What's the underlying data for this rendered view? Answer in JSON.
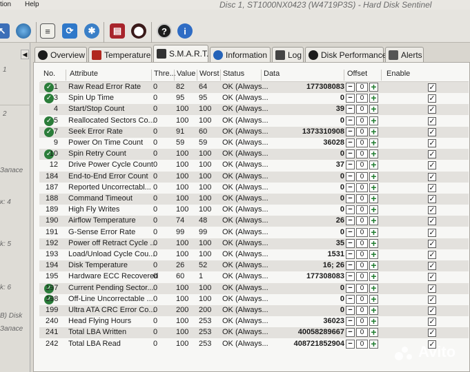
{
  "window": {
    "title": "Disc 1, ST1000NX0423 (W4719P3S) - Hard Disk Sentinel",
    "menu": [
      "tion",
      "Help"
    ]
  },
  "left_pane": [
    "1",
    "2",
    "Запасе",
    "к: 4",
    "k: 5",
    "k: 6",
    "B) Disk",
    "Запасе"
  ],
  "tabs": [
    {
      "label": "Overview",
      "icon": "overview-icon",
      "active": false
    },
    {
      "label": "Temperature",
      "icon": "temperature-icon",
      "active": false
    },
    {
      "label": "S.M.A.R.T.",
      "icon": "smart-icon",
      "active": true
    },
    {
      "label": "Information",
      "icon": "information-icon",
      "active": false
    },
    {
      "label": "Log",
      "icon": "log-icon",
      "active": false
    },
    {
      "label": "Disk Performance",
      "icon": "disk-performance-icon",
      "active": false
    },
    {
      "label": "Alerts",
      "icon": "alerts-icon",
      "active": false
    }
  ],
  "smart_table": {
    "headers": {
      "no": "No.",
      "attribute": "Attribute",
      "threshold": "Thre...",
      "value": "Value",
      "worst": "Worst",
      "status": "Status",
      "data": "Data",
      "offset": "Offset",
      "enable": "Enable"
    },
    "rows": [
      {
        "no": "1",
        "attribute": "Raw Read Error Rate",
        "threshold": "0",
        "value": "82",
        "worst": "64",
        "status": "OK (Always...",
        "data": "177308083",
        "offset": "0",
        "ok_icon": true,
        "enabled": true
      },
      {
        "no": "3",
        "attribute": "Spin Up Time",
        "threshold": "0",
        "value": "95",
        "worst": "95",
        "status": "OK (Always...",
        "data": "0",
        "offset": "0",
        "ok_icon": true,
        "enabled": true
      },
      {
        "no": "4",
        "attribute": "Start/Stop Count",
        "threshold": "0",
        "value": "100",
        "worst": "100",
        "status": "OK (Always...",
        "data": "39",
        "offset": "0",
        "ok_icon": false,
        "enabled": true
      },
      {
        "no": "5",
        "attribute": "Reallocated Sectors Co...",
        "threshold": "0",
        "value": "100",
        "worst": "100",
        "status": "OK (Always...",
        "data": "0",
        "offset": "0",
        "ok_icon": true,
        "enabled": true
      },
      {
        "no": "7",
        "attribute": "Seek Error Rate",
        "threshold": "0",
        "value": "91",
        "worst": "60",
        "status": "OK (Always...",
        "data": "1373310908",
        "offset": "0",
        "ok_icon": true,
        "enabled": true
      },
      {
        "no": "9",
        "attribute": "Power On Time Count",
        "threshold": "0",
        "value": "59",
        "worst": "59",
        "status": "OK (Always...",
        "data": "36028",
        "offset": "0",
        "ok_icon": false,
        "enabled": true
      },
      {
        "no": "10",
        "attribute": "Spin Retry Count",
        "threshold": "0",
        "value": "100",
        "worst": "100",
        "status": "OK (Always...",
        "data": "0",
        "offset": "0",
        "ok_icon": true,
        "enabled": true
      },
      {
        "no": "12",
        "attribute": "Drive Power Cycle Count",
        "threshold": "0",
        "value": "100",
        "worst": "100",
        "status": "OK (Always...",
        "data": "37",
        "offset": "0",
        "ok_icon": false,
        "enabled": true
      },
      {
        "no": "184",
        "attribute": "End-to-End Error Count",
        "threshold": "0",
        "value": "100",
        "worst": "100",
        "status": "OK (Always...",
        "data": "0",
        "offset": "0",
        "ok_icon": false,
        "enabled": true
      },
      {
        "no": "187",
        "attribute": "Reported Uncorrectabl...",
        "threshold": "0",
        "value": "100",
        "worst": "100",
        "status": "OK (Always...",
        "data": "0",
        "offset": "0",
        "ok_icon": false,
        "enabled": true
      },
      {
        "no": "188",
        "attribute": "Command Timeout",
        "threshold": "0",
        "value": "100",
        "worst": "100",
        "status": "OK (Always...",
        "data": "0",
        "offset": "0",
        "ok_icon": false,
        "enabled": true
      },
      {
        "no": "189",
        "attribute": "High Fly Writes",
        "threshold": "0",
        "value": "100",
        "worst": "100",
        "status": "OK (Always...",
        "data": "0",
        "offset": "0",
        "ok_icon": false,
        "enabled": true
      },
      {
        "no": "190",
        "attribute": "Airflow Temperature",
        "threshold": "0",
        "value": "74",
        "worst": "48",
        "status": "OK (Always...",
        "data": "26",
        "offset": "0",
        "ok_icon": false,
        "enabled": true
      },
      {
        "no": "191",
        "attribute": "G-Sense Error Rate",
        "threshold": "0",
        "value": "99",
        "worst": "99",
        "status": "OK (Always...",
        "data": "0",
        "offset": "0",
        "ok_icon": false,
        "enabled": true
      },
      {
        "no": "192",
        "attribute": "Power off Retract Cycle ...",
        "threshold": "0",
        "value": "100",
        "worst": "100",
        "status": "OK (Always...",
        "data": "35",
        "offset": "0",
        "ok_icon": false,
        "enabled": true
      },
      {
        "no": "193",
        "attribute": "Load/Unload Cycle Cou...",
        "threshold": "0",
        "value": "100",
        "worst": "100",
        "status": "OK (Always...",
        "data": "1531",
        "offset": "0",
        "ok_icon": false,
        "enabled": true
      },
      {
        "no": "194",
        "attribute": "Disk Temperature",
        "threshold": "0",
        "value": "26",
        "worst": "52",
        "status": "OK (Always...",
        "data": "16; 26",
        "offset": "0",
        "ok_icon": false,
        "enabled": true
      },
      {
        "no": "195",
        "attribute": "Hardware ECC Recovered",
        "threshold": "0",
        "value": "60",
        "worst": "1",
        "status": "OK (Always...",
        "data": "177308083",
        "offset": "0",
        "ok_icon": false,
        "enabled": true
      },
      {
        "no": "197",
        "attribute": "Current Pending Sector...",
        "threshold": "0",
        "value": "100",
        "worst": "100",
        "status": "OK (Always...",
        "data": "0",
        "offset": "0",
        "ok_icon": true,
        "enabled": true
      },
      {
        "no": "198",
        "attribute": "Off-Line Uncorrectable ...",
        "threshold": "0",
        "value": "100",
        "worst": "100",
        "status": "OK (Always...",
        "data": "0",
        "offset": "0",
        "ok_icon": true,
        "enabled": true
      },
      {
        "no": "199",
        "attribute": "Ultra ATA CRC Error Co...",
        "threshold": "0",
        "value": "200",
        "worst": "200",
        "status": "OK (Always...",
        "data": "0",
        "offset": "0",
        "ok_icon": false,
        "enabled": true
      },
      {
        "no": "240",
        "attribute": "Head Flying Hours",
        "threshold": "0",
        "value": "100",
        "worst": "253",
        "status": "OK (Always...",
        "data": "36023",
        "offset": "0",
        "ok_icon": false,
        "enabled": true
      },
      {
        "no": "241",
        "attribute": "Total LBA Written",
        "threshold": "0",
        "value": "100",
        "worst": "253",
        "status": "OK (Always...",
        "data": "40058289667",
        "offset": "0",
        "ok_icon": false,
        "enabled": true
      },
      {
        "no": "242",
        "attribute": "Total LBA Read",
        "threshold": "0",
        "value": "100",
        "worst": "253",
        "status": "OK (Always...",
        "data": "408721852904",
        "offset": "0",
        "ok_icon": false,
        "enabled": true
      }
    ]
  },
  "watermark": "Avito",
  "colors": {
    "ok_green": "#2b7d3a",
    "plus_green": "#1d7a2c",
    "alt_row": "#e3e1dd"
  }
}
